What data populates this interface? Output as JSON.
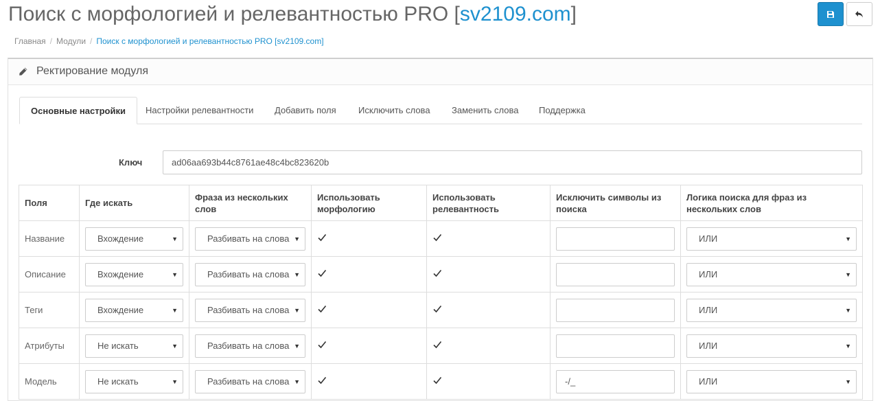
{
  "header": {
    "title": "Поиск с морфологией и релевантностью PRO [",
    "title_brand": "sv2109.com",
    "title_end": "]",
    "save_icon": "save-icon",
    "back_icon": "reply-icon"
  },
  "breadcrumb": [
    "Главная",
    "Модули",
    "Поиск с морфологией и релевантностью PRO [sv2109.com]"
  ],
  "panel": {
    "title": "Ректирование модуля",
    "icon": "pencil-icon"
  },
  "tabs": [
    "Основные настройки",
    "Настройки релевантности",
    "Добавить поля",
    "Исключить слова",
    "Заменить слова",
    "Поддержка"
  ],
  "key": {
    "label": "Ключ",
    "value": "ad06aa693b44c8761ae48c4bc823620b"
  },
  "table": {
    "headers": [
      "Поля",
      "Где искать",
      "Фраза из нескольких слов",
      "Использовать морфологию",
      "Использовать релевантность",
      "Исключить символы из поиска",
      "Логика поиска для фраз из нескольких слов"
    ],
    "rows": [
      {
        "field": "Название",
        "where": "Вхождение",
        "phrase": "Разбивать на слова",
        "morphology": true,
        "relevance": true,
        "exclude": "",
        "logic": "ИЛИ"
      },
      {
        "field": "Описание",
        "where": "Вхождение",
        "phrase": "Разбивать на слова",
        "morphology": true,
        "relevance": true,
        "exclude": "",
        "logic": "ИЛИ"
      },
      {
        "field": "Теги",
        "where": "Вхождение",
        "phrase": "Разбивать на слова",
        "morphology": true,
        "relevance": true,
        "exclude": "",
        "logic": "ИЛИ"
      },
      {
        "field": "Атрибуты",
        "where": "Не искать",
        "phrase": "Разбивать на слова",
        "morphology": true,
        "relevance": true,
        "exclude": "",
        "logic": "ИЛИ"
      },
      {
        "field": "Модель",
        "where": "Не искать",
        "phrase": "Разбивать на слова",
        "morphology": true,
        "relevance": true,
        "exclude": "-/_",
        "logic": "ИЛИ"
      }
    ]
  },
  "colors": {
    "accent": "#1e91cf",
    "border": "#dddddd"
  }
}
